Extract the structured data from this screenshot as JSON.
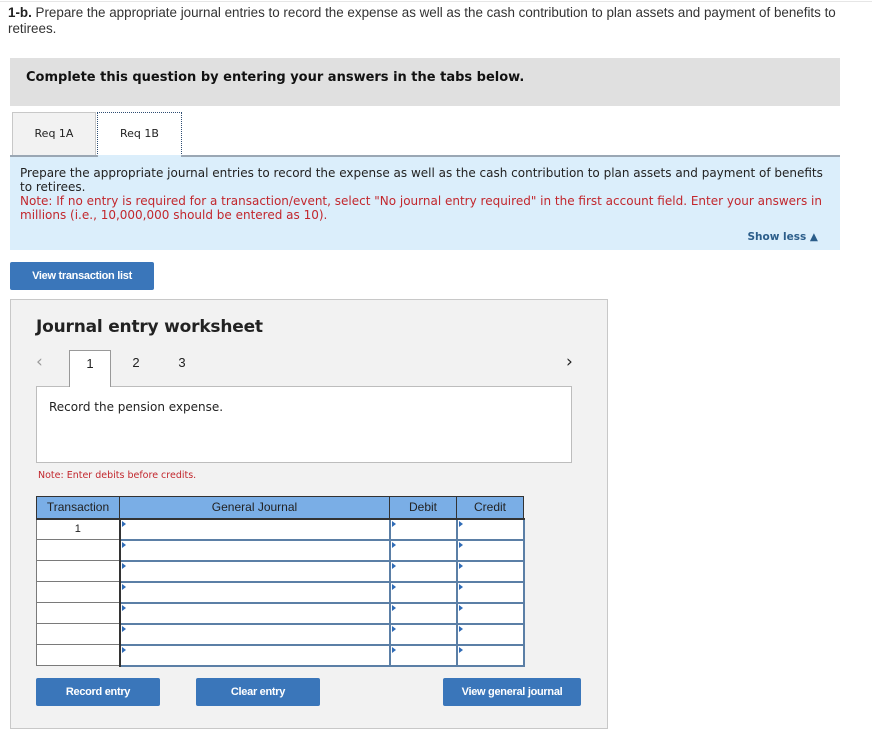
{
  "prompt": {
    "label": "1-b.",
    "text": " Prepare the appropriate journal entries to record the expense as well as the cash contribution to plan assets and payment of benefits to retirees."
  },
  "instruction_bar": "Complete this question by entering your answers in the tabs below.",
  "tabs": [
    {
      "label": "Req 1A",
      "active": false
    },
    {
      "label": "Req 1B",
      "active": true
    }
  ],
  "info": {
    "text": "Prepare the appropriate journal entries to record the expense as well as the cash contribution to plan assets and payment of benefits to retirees.",
    "note": "Note: If no entry is required for a transaction/event, select \"No journal entry required\" in the first account field. Enter your answers in millions (i.e., 10,000,000 should be entered as 10).",
    "show_less": "Show less ▲"
  },
  "buttons": {
    "view_transaction_list": "View transaction list",
    "record_entry": "Record entry",
    "clear_entry": "Clear entry",
    "view_general_journal": "View general journal"
  },
  "worksheet": {
    "title": "Journal entry worksheet",
    "prev_icon": "‹",
    "next_icon": "›",
    "pages": [
      "1",
      "2",
      "3"
    ],
    "active_page": "1",
    "description": "Record the pension expense.",
    "note": "Note: Enter debits before credits."
  },
  "table": {
    "headers": {
      "transaction": "Transaction",
      "general_journal": "General Journal",
      "debit": "Debit",
      "credit": "Credit"
    },
    "rows": [
      {
        "transaction": "1",
        "account": "",
        "debit": "",
        "credit": ""
      },
      {
        "transaction": "",
        "account": "",
        "debit": "",
        "credit": ""
      },
      {
        "transaction": "",
        "account": "",
        "debit": "",
        "credit": ""
      },
      {
        "transaction": "",
        "account": "",
        "debit": "",
        "credit": ""
      },
      {
        "transaction": "",
        "account": "",
        "debit": "",
        "credit": ""
      },
      {
        "transaction": "",
        "account": "",
        "debit": "",
        "credit": ""
      },
      {
        "transaction": "",
        "account": "",
        "debit": "",
        "credit": ""
      }
    ]
  },
  "colors": {
    "accent_button": "#3a76ba",
    "info_bg": "#dbeefb",
    "note_red": "#c2272d",
    "table_header": "#7aaee6"
  }
}
